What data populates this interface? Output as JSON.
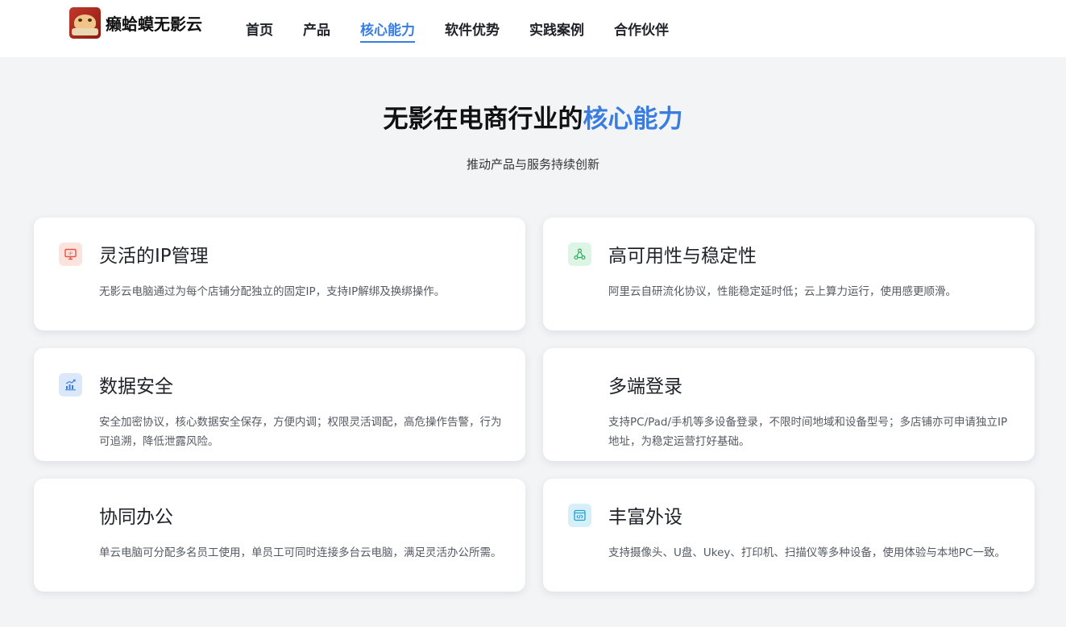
{
  "nav": {
    "logo_text": "癞蛤蟆无影云",
    "items": [
      {
        "label": "首页"
      },
      {
        "label": "产品"
      },
      {
        "label": "核心能力",
        "active": true
      },
      {
        "label": "软件优势"
      },
      {
        "label": "实践案例"
      },
      {
        "label": "合作伙伴"
      }
    ]
  },
  "hero": {
    "title_prefix": "无影在电商行业的",
    "title_highlight": "核心能力",
    "subtitle": "推动产品与服务持续创新"
  },
  "colors": {
    "accent": "#3a7de0"
  },
  "cards": [
    {
      "title": "灵活的IP管理",
      "desc": "无影云电脑通过为每个店铺分配独立的固定IP，支持IP解绑及换绑操作。",
      "icon": "ip-monitor-icon"
    },
    {
      "title": "高可用性与稳定性",
      "desc": "阿里云自研流化协议，性能稳定延时低；云上算力运行，使用感更顺滑。",
      "icon": "network-nodes-icon"
    },
    {
      "title": "数据安全",
      "desc": "安全加密协议，核心数据安全保存，方便内调；权限灵活调配，高危操作告警，行为可追溯，降低泄露风险。",
      "icon": "chart-growth-icon"
    },
    {
      "title": "多端登录",
      "desc": "支持PC/Pad/手机等多设备登录，不限时间地域和设备型号；多店铺亦可申请独立IP地址，为稳定运营打好基础。",
      "icon": ""
    },
    {
      "title": "协同办公",
      "desc": "单云电脑可分配多名员工使用，单员工可同时连接多台云电脑，满足灵活办公所需。",
      "icon": ""
    },
    {
      "title": "丰富外设",
      "desc": "支持摄像头、U盘、Ukey、打印机、扫描仪等多种设备，使用体验与本地PC一致。",
      "icon": "code-window-icon"
    }
  ]
}
